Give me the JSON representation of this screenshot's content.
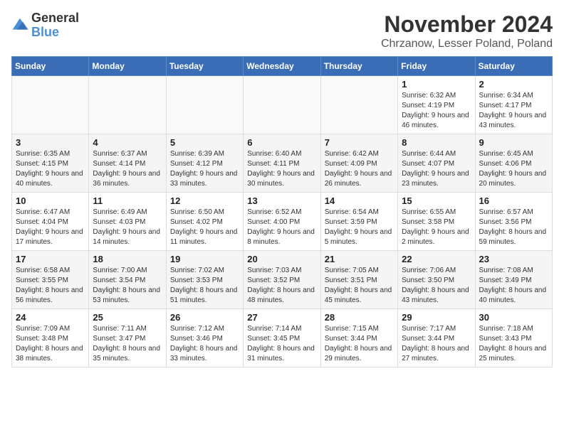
{
  "logo": {
    "general": "General",
    "blue": "Blue"
  },
  "header": {
    "month": "November 2024",
    "location": "Chrzanow, Lesser Poland, Poland"
  },
  "weekdays": [
    "Sunday",
    "Monday",
    "Tuesday",
    "Wednesday",
    "Thursday",
    "Friday",
    "Saturday"
  ],
  "weeks": [
    [
      {
        "day": "",
        "info": ""
      },
      {
        "day": "",
        "info": ""
      },
      {
        "day": "",
        "info": ""
      },
      {
        "day": "",
        "info": ""
      },
      {
        "day": "",
        "info": ""
      },
      {
        "day": "1",
        "info": "Sunrise: 6:32 AM\nSunset: 4:19 PM\nDaylight: 9 hours and 46 minutes."
      },
      {
        "day": "2",
        "info": "Sunrise: 6:34 AM\nSunset: 4:17 PM\nDaylight: 9 hours and 43 minutes."
      }
    ],
    [
      {
        "day": "3",
        "info": "Sunrise: 6:35 AM\nSunset: 4:15 PM\nDaylight: 9 hours and 40 minutes."
      },
      {
        "day": "4",
        "info": "Sunrise: 6:37 AM\nSunset: 4:14 PM\nDaylight: 9 hours and 36 minutes."
      },
      {
        "day": "5",
        "info": "Sunrise: 6:39 AM\nSunset: 4:12 PM\nDaylight: 9 hours and 33 minutes."
      },
      {
        "day": "6",
        "info": "Sunrise: 6:40 AM\nSunset: 4:11 PM\nDaylight: 9 hours and 30 minutes."
      },
      {
        "day": "7",
        "info": "Sunrise: 6:42 AM\nSunset: 4:09 PM\nDaylight: 9 hours and 26 minutes."
      },
      {
        "day": "8",
        "info": "Sunrise: 6:44 AM\nSunset: 4:07 PM\nDaylight: 9 hours and 23 minutes."
      },
      {
        "day": "9",
        "info": "Sunrise: 6:45 AM\nSunset: 4:06 PM\nDaylight: 9 hours and 20 minutes."
      }
    ],
    [
      {
        "day": "10",
        "info": "Sunrise: 6:47 AM\nSunset: 4:04 PM\nDaylight: 9 hours and 17 minutes."
      },
      {
        "day": "11",
        "info": "Sunrise: 6:49 AM\nSunset: 4:03 PM\nDaylight: 9 hours and 14 minutes."
      },
      {
        "day": "12",
        "info": "Sunrise: 6:50 AM\nSunset: 4:02 PM\nDaylight: 9 hours and 11 minutes."
      },
      {
        "day": "13",
        "info": "Sunrise: 6:52 AM\nSunset: 4:00 PM\nDaylight: 9 hours and 8 minutes."
      },
      {
        "day": "14",
        "info": "Sunrise: 6:54 AM\nSunset: 3:59 PM\nDaylight: 9 hours and 5 minutes."
      },
      {
        "day": "15",
        "info": "Sunrise: 6:55 AM\nSunset: 3:58 PM\nDaylight: 9 hours and 2 minutes."
      },
      {
        "day": "16",
        "info": "Sunrise: 6:57 AM\nSunset: 3:56 PM\nDaylight: 8 hours and 59 minutes."
      }
    ],
    [
      {
        "day": "17",
        "info": "Sunrise: 6:58 AM\nSunset: 3:55 PM\nDaylight: 8 hours and 56 minutes."
      },
      {
        "day": "18",
        "info": "Sunrise: 7:00 AM\nSunset: 3:54 PM\nDaylight: 8 hours and 53 minutes."
      },
      {
        "day": "19",
        "info": "Sunrise: 7:02 AM\nSunset: 3:53 PM\nDaylight: 8 hours and 51 minutes."
      },
      {
        "day": "20",
        "info": "Sunrise: 7:03 AM\nSunset: 3:52 PM\nDaylight: 8 hours and 48 minutes."
      },
      {
        "day": "21",
        "info": "Sunrise: 7:05 AM\nSunset: 3:51 PM\nDaylight: 8 hours and 45 minutes."
      },
      {
        "day": "22",
        "info": "Sunrise: 7:06 AM\nSunset: 3:50 PM\nDaylight: 8 hours and 43 minutes."
      },
      {
        "day": "23",
        "info": "Sunrise: 7:08 AM\nSunset: 3:49 PM\nDaylight: 8 hours and 40 minutes."
      }
    ],
    [
      {
        "day": "24",
        "info": "Sunrise: 7:09 AM\nSunset: 3:48 PM\nDaylight: 8 hours and 38 minutes."
      },
      {
        "day": "25",
        "info": "Sunrise: 7:11 AM\nSunset: 3:47 PM\nDaylight: 8 hours and 35 minutes."
      },
      {
        "day": "26",
        "info": "Sunrise: 7:12 AM\nSunset: 3:46 PM\nDaylight: 8 hours and 33 minutes."
      },
      {
        "day": "27",
        "info": "Sunrise: 7:14 AM\nSunset: 3:45 PM\nDaylight: 8 hours and 31 minutes."
      },
      {
        "day": "28",
        "info": "Sunrise: 7:15 AM\nSunset: 3:44 PM\nDaylight: 8 hours and 29 minutes."
      },
      {
        "day": "29",
        "info": "Sunrise: 7:17 AM\nSunset: 3:44 PM\nDaylight: 8 hours and 27 minutes."
      },
      {
        "day": "30",
        "info": "Sunrise: 7:18 AM\nSunset: 3:43 PM\nDaylight: 8 hours and 25 minutes."
      }
    ]
  ]
}
